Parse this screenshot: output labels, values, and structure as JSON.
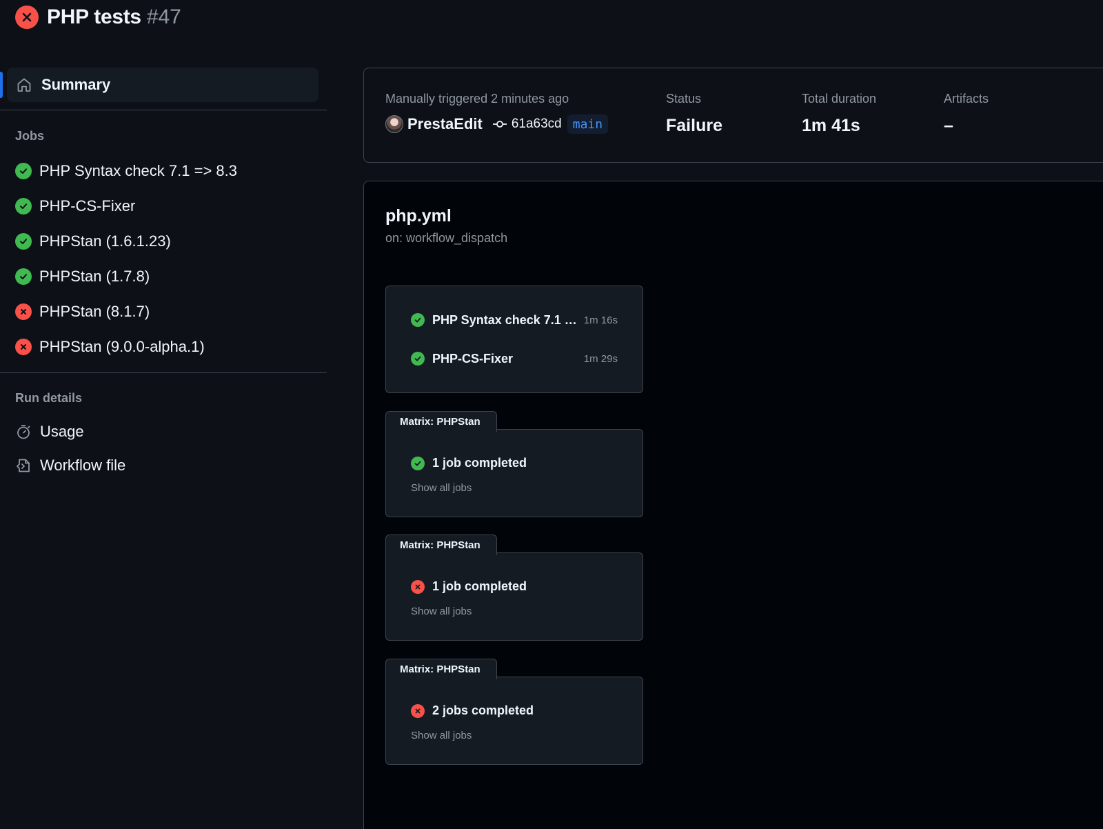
{
  "header": {
    "title": "PHP tests",
    "run_number": "#47",
    "status": "failure"
  },
  "sidebar": {
    "summary_label": "Summary",
    "jobs_heading": "Jobs",
    "jobs": [
      {
        "label": "PHP Syntax check 7.1 => 8.3",
        "status": "success"
      },
      {
        "label": "PHP-CS-Fixer",
        "status": "success"
      },
      {
        "label": "PHPStan (1.6.1.23)",
        "status": "success"
      },
      {
        "label": "PHPStan (1.7.8)",
        "status": "success"
      },
      {
        "label": "PHPStan (8.1.7)",
        "status": "failure"
      },
      {
        "label": "PHPStan (9.0.0-alpha.1)",
        "status": "failure"
      }
    ],
    "run_details_heading": "Run details",
    "details": [
      {
        "label": "Usage",
        "icon": "stopwatch-icon"
      },
      {
        "label": "Workflow file",
        "icon": "file-code-icon"
      }
    ]
  },
  "summary": {
    "trigger_text": "Manually triggered 2 minutes ago",
    "actor": "PrestaEdit",
    "commit_sha": "61a63cd",
    "branch": "main",
    "status_label": "Status",
    "status_value": "Failure",
    "duration_label": "Total duration",
    "duration_value": "1m 41s",
    "artifacts_label": "Artifacts",
    "artifacts_value": "–"
  },
  "graph": {
    "workflow_file": "php.yml",
    "trigger": "on: workflow_dispatch",
    "jobs_group": [
      {
        "name": "PHP Syntax check 7.1 =...",
        "duration": "1m 16s",
        "status": "success"
      },
      {
        "name": "PHP-CS-Fixer",
        "duration": "1m 29s",
        "status": "success"
      }
    ],
    "matrices": [
      {
        "tab": "Matrix: PHPStan",
        "summary": "1 job completed",
        "status": "success",
        "show_all": "Show all jobs"
      },
      {
        "tab": "Matrix: PHPStan",
        "summary": "1 job completed",
        "status": "failure",
        "show_all": "Show all jobs"
      },
      {
        "tab": "Matrix: PHPStan",
        "summary": "2 jobs completed",
        "status": "failure",
        "show_all": "Show all jobs"
      }
    ]
  },
  "colors": {
    "success": "#3fb950",
    "failure": "#f85149",
    "accent": "#1f6feb",
    "background": "#0d1117"
  }
}
